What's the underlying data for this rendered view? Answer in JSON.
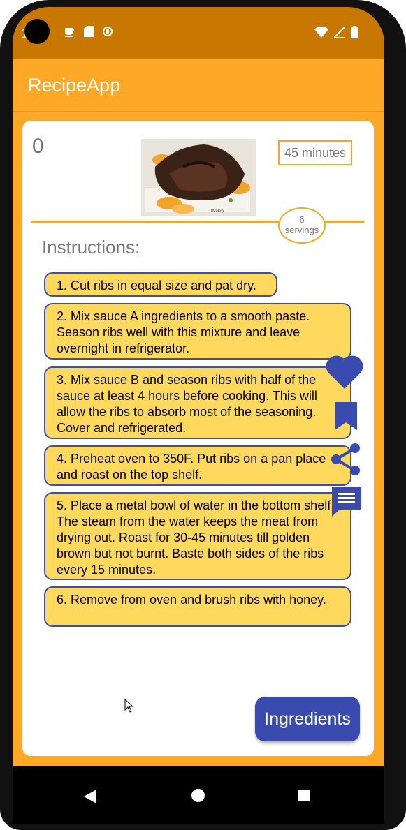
{
  "status": {
    "time": "1",
    "left_icons": [
      "cup-icon",
      "sd-card-icon",
      "sync-icon"
    ],
    "right_icons": [
      "wifi-icon",
      "signal-icon",
      "battery-icon"
    ]
  },
  "app": {
    "title": "RecipeApp"
  },
  "recipe": {
    "rating": "0",
    "time": "45 minutes",
    "servings_number": "6",
    "servings_label": "servings",
    "image": "ribs-photo"
  },
  "instructions": {
    "heading": "Instructions:",
    "steps": [
      "1. Cut ribs in equal size and pat dry.",
      "2. Mix sauce A ingredients to a smooth paste. Season ribs well with this mixture and leave overnight in refrigerator.",
      "3. Mix sauce B and season ribs with half of the sauce at least 4 hours before cooking. This will allow the ribs to absorb most of the seasoning. Cover and refrigerated.",
      "4. Preheat oven to 350F. Put ribs on a pan place and roast on the top shelf.",
      "5. Place a metal bowl of water in the bottom shelf. The steam from the water keeps the meat from drying out. Roast for 30-45 minutes till golden brown but not burnt. Baste both sides of the ribs every 15 minutes.",
      "6. Remove from oven and brush ribs with honey."
    ]
  },
  "actions": {
    "icons": [
      "heart-icon",
      "bookmark-icon",
      "share-icon",
      "comment-icon"
    ],
    "accent": "#3a4bb0"
  },
  "ingredients_button": "Ingredients",
  "colors": {
    "status_bar": "#c87800",
    "app_bar": "#ffa726",
    "step_bg": "#ffd95e",
    "step_border": "#3f4fa8",
    "accent": "#3a4bb0"
  }
}
